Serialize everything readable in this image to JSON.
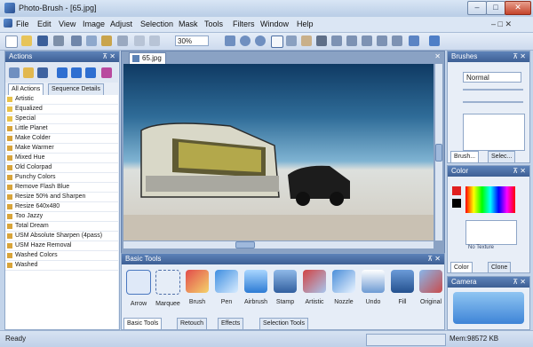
{
  "window": {
    "title": "Photo-Brush - [65.jpg]",
    "minimize": "–",
    "maximize": "□",
    "close": "✕"
  },
  "menu": [
    "File",
    "Edit",
    "View",
    "Image",
    "Adjust",
    "Selection",
    "Mask",
    "Tools",
    "Filters",
    "Window",
    "Help"
  ],
  "mdi_controls": "– □ ✕",
  "toolbar": {
    "zoom": "30%"
  },
  "actions_panel": {
    "title": "Actions",
    "pin": "⊼ ✕",
    "tabs": [
      "All Actions",
      "Sequence Details"
    ],
    "folders": [
      "Artistic",
      "Equalized",
      "Special"
    ],
    "items": [
      "Little Planet",
      "Make Colder",
      "Make Warmer",
      "Mixed Hue",
      "Old Colorpad",
      "Punchy Colors",
      "Remove Flash Blue",
      "Resize 50% and Sharpen",
      "Resize 640x480",
      "Too Jazzy",
      "Total Dream",
      "USM Absolute Sharpen (4pass)",
      "USM Haze Removal",
      "Washed Colors",
      "Washed"
    ]
  },
  "document": {
    "tab": "65.jpg",
    "close": "✕"
  },
  "basic_tools": {
    "title": "Basic Tools",
    "pin": "⊼ ✕",
    "tools": [
      "Arrow",
      "Marquee",
      "Brush",
      "Pen",
      "Airbrush",
      "Stamp",
      "Artistic",
      "Nozzle",
      "Undo",
      "Fill",
      "Original"
    ],
    "tabs": [
      "Basic Tools",
      "Retouch",
      "Effects",
      "Selection Tools"
    ]
  },
  "brushes_panel": {
    "title": "Brushes",
    "pin": "⊼ ✕",
    "mode": "Normal",
    "tabs": [
      "Brush...",
      "Selec..."
    ]
  },
  "color_panel": {
    "title": "Color",
    "pin": "⊼ ✕",
    "texture_label": "No Texture",
    "tabs": [
      "Color",
      "Clone"
    ]
  },
  "camera_panel": {
    "title": "Camera",
    "pin": "⊼ ✕"
  },
  "status": {
    "left": "Ready",
    "memory": "Mem:98572 KB"
  }
}
